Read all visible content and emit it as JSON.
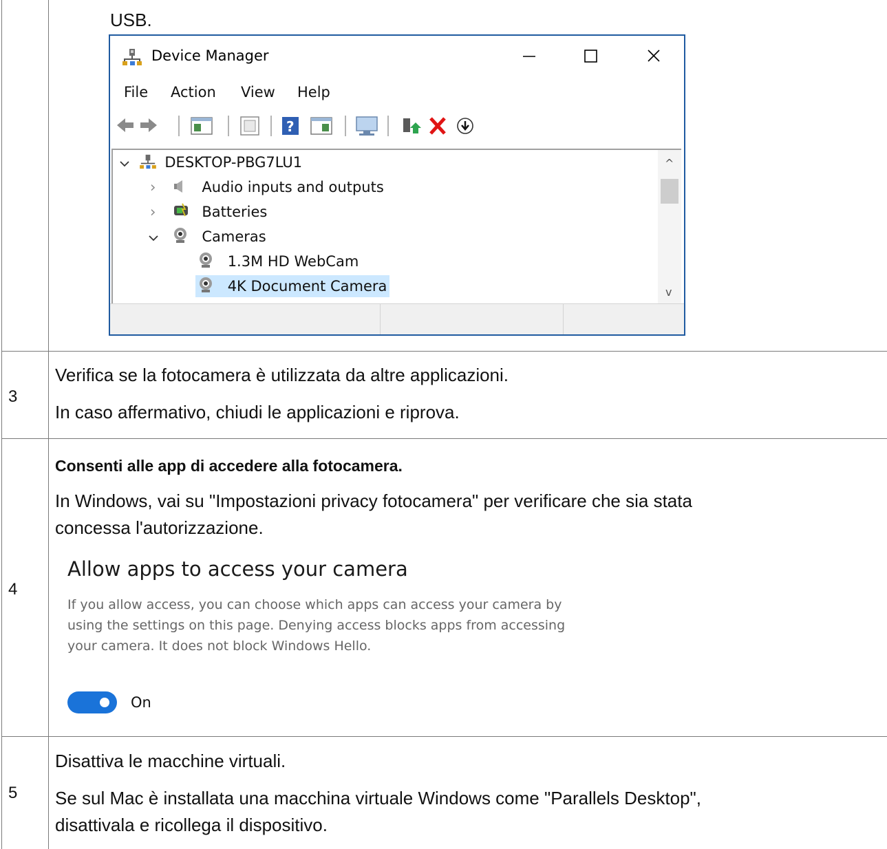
{
  "top_text": "USB.",
  "device_manager": {
    "title": "Device Manager",
    "window_buttons": {
      "minimize": "—",
      "maximize": "☐",
      "close": "✕"
    },
    "menu": [
      "File",
      "Action",
      "View",
      "Help"
    ],
    "tree": {
      "root": "DESKTOP-PBG7LU1",
      "items": [
        {
          "label": "Audio inputs and outputs",
          "icon": "speaker-icon",
          "expanded": false
        },
        {
          "label": "Batteries",
          "icon": "battery-icon",
          "expanded": false
        },
        {
          "label": "Cameras",
          "icon": "webcam-icon",
          "expanded": true
        }
      ],
      "children": [
        {
          "label": "1.3M HD WebCam",
          "icon": "webcam-icon",
          "selected": false
        },
        {
          "label": "4K Document Camera",
          "icon": "webcam-icon",
          "selected": true
        }
      ]
    },
    "scroll_up": "^",
    "scroll_down": "v"
  },
  "rows": [
    {
      "number": "3",
      "lines": [
        "Verifica se la fotocamera è utilizzata da altre applicazioni.",
        "In caso affermativo, chiudi le applicazioni e riprova."
      ]
    },
    {
      "number": "4",
      "heading": "Consenti alle app di accedere alla fotocamera.",
      "lines": [
        "In Windows, vai su \"Impostazioni privacy fotocamera\" per verificare che sia stata",
        "concessa l'autorizzazione."
      ],
      "settings": {
        "title": "Allow apps to access your camera",
        "description": "If you allow access, you can choose which apps can access your camera by using the settings on this page. Denying access blocks apps from accessing your camera. It does not block Windows Hello.",
        "toggle_state": "On",
        "accent": "#1a73d9"
      }
    },
    {
      "number": "5",
      "lines": [
        "Disattiva le macchine virtuali.",
        "Se sul Mac è installata una macchina virtuale Windows come \"Parallels Desktop\",",
        "disattivala e ricollega il dispositivo."
      ]
    }
  ]
}
